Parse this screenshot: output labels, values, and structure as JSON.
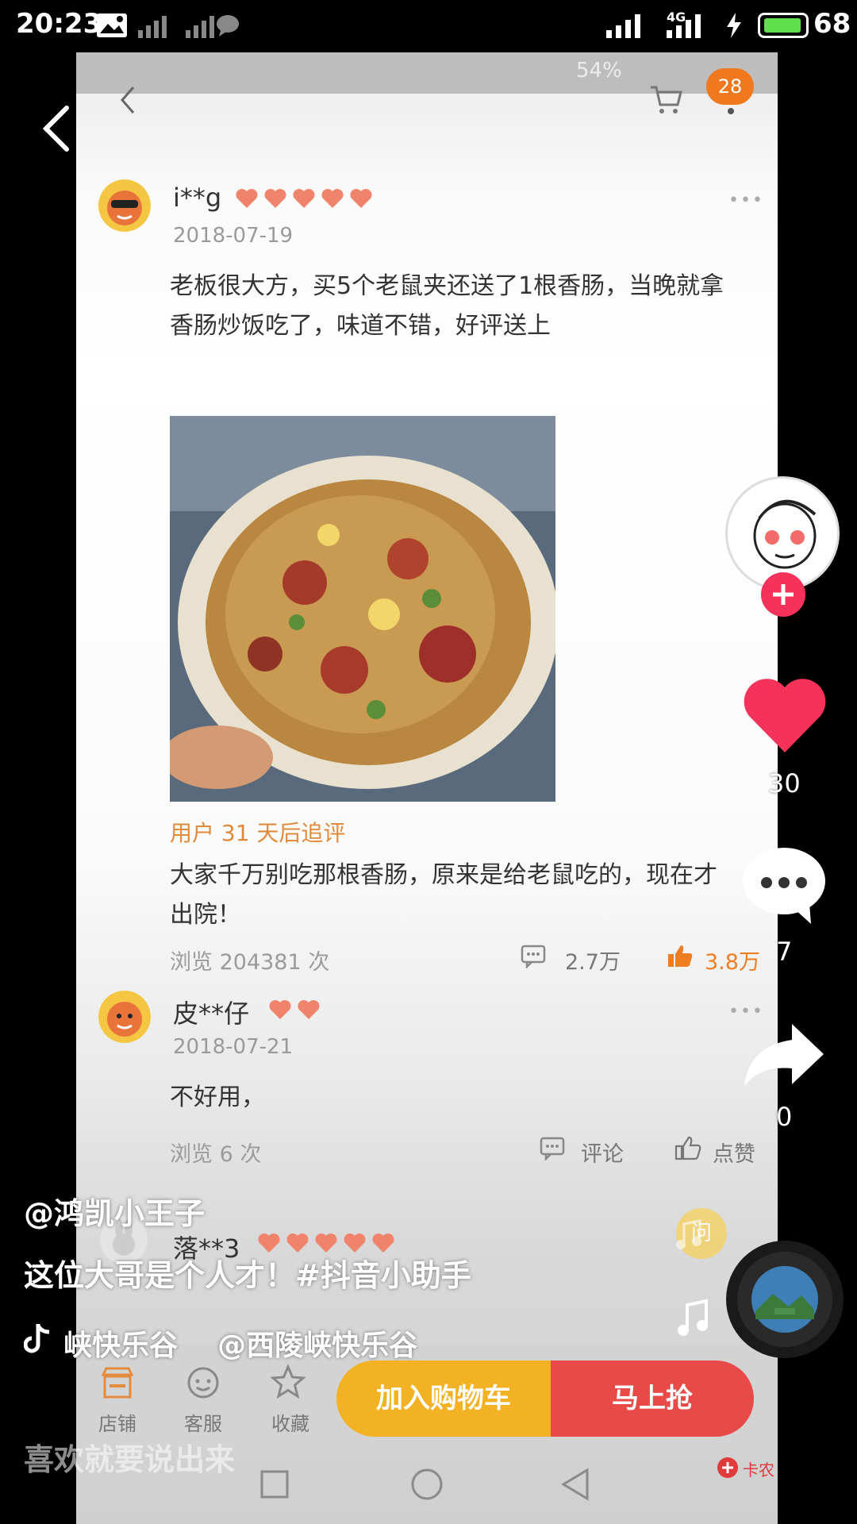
{
  "status_bar": {
    "time": "20:23",
    "battery": "68",
    "network": "4G"
  },
  "inner_status": {
    "text": "54%"
  },
  "nav": {
    "cart_badge": "28"
  },
  "reviews": [
    {
      "user": "i**g",
      "date": "2018-07-19",
      "text": "老板很大方，买5个老鼠夹还送了1根香肠，当晚就拿香肠炒饭吃了，味道不错，好评送上",
      "followup_label": "用户 31 天后追评",
      "followup_text": "大家千万别吃那根香肠，原来是给老鼠吃的，现在才出院！",
      "views": "浏览 204381 次",
      "comments": "2.7万",
      "likes": "3.8万"
    },
    {
      "user": "皮**仔",
      "date": "2018-07-21",
      "text": "不好用，",
      "views": "浏览 6 次",
      "comments": "评论",
      "likes": "点赞"
    },
    {
      "user": "落**3"
    }
  ],
  "shop_bar": {
    "store": "店铺",
    "service": "客服",
    "favorite": "收藏",
    "add_to_cart": "加入购物车",
    "buy_now": "马上抢"
  },
  "overlay": {
    "like_count": "30",
    "comment_count": "7",
    "share_count": "0",
    "author": "@鸿凯小王子",
    "caption": "这位大哥是个人才！#抖音小助手",
    "music": "峡快乐谷    @西陵峡快乐谷",
    "comment_hint": "喜欢就要说出来",
    "ask_label": "问",
    "watermark": "卡农"
  }
}
